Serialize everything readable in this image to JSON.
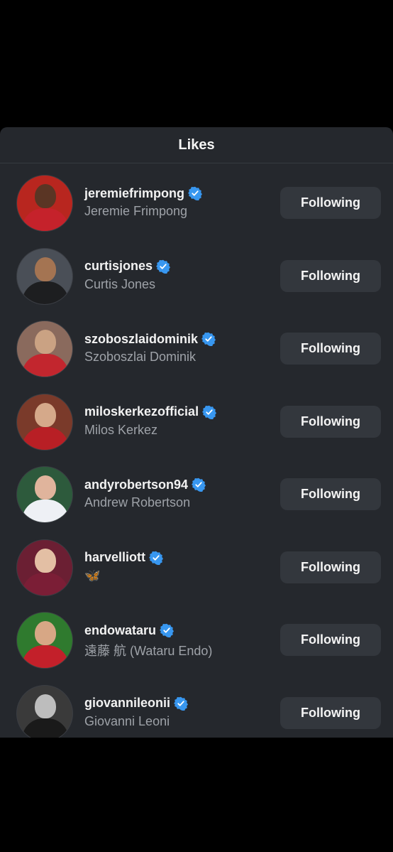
{
  "sheet": {
    "title": "Likes"
  },
  "users": [
    {
      "username": "jeremiefrimpong",
      "fullname": "Jeremie Frimpong",
      "button": "Following",
      "avatar": {
        "bg": "#b8261f",
        "skin": "#5a3524",
        "shirt": "#c5222b"
      }
    },
    {
      "username": "curtisjones",
      "fullname": "Curtis Jones",
      "button": "Following",
      "avatar": {
        "bg": "#4a4f57",
        "skin": "#a47452",
        "shirt": "#1d1e20"
      }
    },
    {
      "username": "szoboszlaidominik",
      "fullname": "Szoboszlai Dominik",
      "button": "Following",
      "avatar": {
        "bg": "#8a6a5d",
        "skin": "#caa283",
        "shirt": "#c2262e"
      }
    },
    {
      "username": "miloskerkezofficial",
      "fullname": "Milos Kerkez",
      "button": "Following",
      "avatar": {
        "bg": "#7a3a2a",
        "skin": "#d5a98a",
        "shirt": "#b81f25"
      }
    },
    {
      "username": "andyrobertson94",
      "fullname": "Andrew Robertson",
      "button": "Following",
      "avatar": {
        "bg": "#2d5a3c",
        "skin": "#e0b49c",
        "shirt": "#eef0f5"
      }
    },
    {
      "username": "harvelliott",
      "fullname": "🦋",
      "button": "Following",
      "avatar": {
        "bg": "#6b1f33",
        "skin": "#e3bfa4",
        "shirt": "#7b1e36"
      }
    },
    {
      "username": "endowataru",
      "fullname": "遠藤 航 (Wataru Endo)",
      "button": "Following",
      "avatar": {
        "bg": "#2f7a2e",
        "skin": "#d7a785",
        "shirt": "#c3202a"
      }
    },
    {
      "username": "giovannileonii",
      "fullname": "Giovanni Leoni",
      "button": "Following",
      "avatar": {
        "bg": "#3a3a3a",
        "skin": "#bdbdbd",
        "shirt": "#1a1a1a"
      }
    }
  ],
  "colors": {
    "verified": "#3897f0",
    "background": "#25282d",
    "button_bg": "#33373d"
  }
}
